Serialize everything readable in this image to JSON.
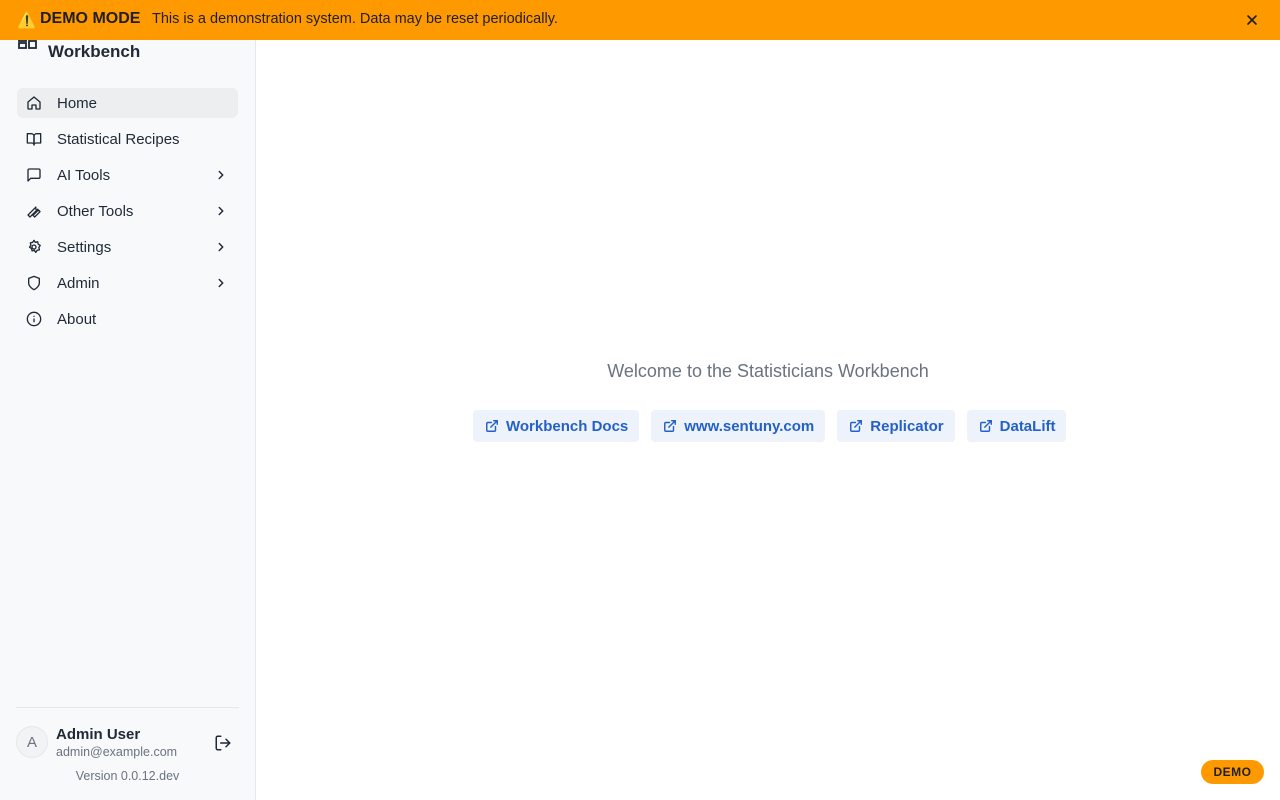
{
  "banner": {
    "warning_icon": "⚠️",
    "title": "DEMO MODE",
    "message": "This is a demonstration system. Data may be reset periodically.",
    "close_icon": "close-icon",
    "color": "#ff9900"
  },
  "sidebar": {
    "title": "Workbench",
    "logo_icon": "layout-grid-icon",
    "items": [
      {
        "label": "Home",
        "icon": "home-icon",
        "active": true,
        "has_submenu": false
      },
      {
        "label": "Statistical Recipes",
        "icon": "book-open-icon",
        "active": false,
        "has_submenu": false
      },
      {
        "label": "AI Tools",
        "icon": "message-square-icon",
        "active": false,
        "has_submenu": true
      },
      {
        "label": "Other Tools",
        "icon": "wrench-icon",
        "active": false,
        "has_submenu": true
      },
      {
        "label": "Settings",
        "icon": "gear-icon",
        "active": false,
        "has_submenu": true
      },
      {
        "label": "Admin",
        "icon": "shield-icon",
        "active": false,
        "has_submenu": true
      },
      {
        "label": "About",
        "icon": "info-icon",
        "active": false,
        "has_submenu": false
      }
    ],
    "user": {
      "avatar_initial": "A",
      "name": "Admin User",
      "email": "admin@example.com",
      "logout_icon": "logout-icon"
    },
    "version": "Version 0.0.12.dev"
  },
  "main": {
    "welcome": "Welcome to the Statisticians Workbench",
    "links": [
      {
        "label": "Workbench Docs",
        "icon": "external-link-icon"
      },
      {
        "label": "www.sentuny.com",
        "icon": "external-link-icon"
      },
      {
        "label": "Replicator",
        "icon": "external-link-icon"
      },
      {
        "label": "DataLift",
        "icon": "external-link-icon"
      }
    ],
    "link_color": "#2361c9"
  },
  "demo_badge": "DEMO"
}
